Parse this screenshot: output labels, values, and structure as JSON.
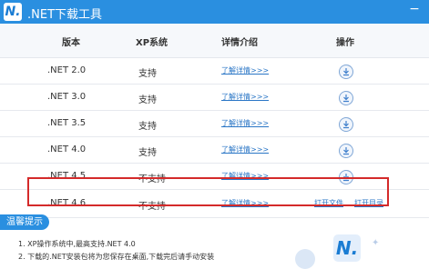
{
  "window": {
    "logo_text": "N.",
    "title": ".NET下载工具",
    "minimize_symbol": "−"
  },
  "table": {
    "headers": [
      "版本",
      "XP系统",
      "详情介绍",
      "操作"
    ],
    "rows": [
      {
        "version": ".NET 2.0",
        "xp_support": "支持",
        "details": "了解详情>>>",
        "action": "download-icon"
      },
      {
        "version": ".NET 3.0",
        "xp_support": "支持",
        "details": "了解详情>>>",
        "action": "download-icon"
      },
      {
        "version": ".NET 3.5",
        "xp_support": "支持",
        "details": "了解详情>>>",
        "action": "download-icon"
      },
      {
        "version": ".NET 4.0",
        "xp_support": "支持",
        "details": "了解详情>>>",
        "action": "download-icon"
      },
      {
        "version": ".NET 4.5",
        "xp_support": "不支持",
        "details": "了解详情>>>",
        "action": "download-icon"
      },
      {
        "version": ".NET 4.6",
        "xp_support": "不支持",
        "details": "了解详情>>>",
        "open_file": "打开文件",
        "open_dir": "打开目录"
      }
    ],
    "highlight_color": "#d42a2a"
  },
  "tips": {
    "badge": "温馨提示",
    "items": [
      "1. XP操作系统中,最高支持.NET 4.0",
      "2. 下载的.NET安装包将为您保存在桌面,下载完后请手动安装"
    ]
  },
  "colors": {
    "accent": "#2a8fe0",
    "link": "#2a76c6"
  }
}
